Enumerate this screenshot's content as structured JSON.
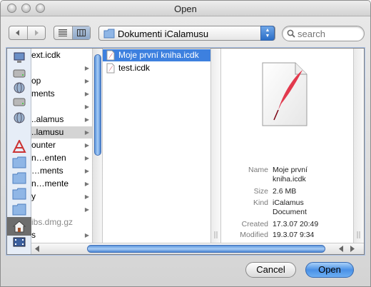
{
  "window": {
    "title": "Open"
  },
  "toolbar": {
    "back_icon": "back-arrow-icon",
    "forward_icon": "forward-arrow-icon",
    "location": "Dokumenti iCalamusu",
    "search_placeholder": "search"
  },
  "sidebar": {
    "items": [
      "computer-icon",
      "disk-icon",
      "network-disk-icon",
      "disk-icon",
      "network-disk-icon",
      "applications-icon",
      "folder-icon",
      "folder-icon",
      "folder-icon",
      "folder-icon",
      "home-icon",
      "movies-icon"
    ]
  },
  "column1": {
    "rows": [
      {
        "label": "ext.icdk",
        "arrow": false
      },
      {
        "label": "",
        "arrow": true
      },
      {
        "label": "op",
        "arrow": true
      },
      {
        "label": "ments",
        "arrow": true
      },
      {
        "label": "",
        "arrow": true
      },
      {
        "label": "..alamus",
        "arrow": true
      },
      {
        "label": "..lamusu",
        "arrow": true
      },
      {
        "label": "ounter",
        "arrow": true
      },
      {
        "label": "n…enten",
        "arrow": true
      },
      {
        "label": "…ments",
        "arrow": true
      },
      {
        "label": "n…mente",
        "arrow": true
      },
      {
        "label": "y",
        "arrow": true
      },
      {
        "label": "",
        "arrow": true
      },
      {
        "label": "ibs.dmg.gz",
        "arrow": false
      },
      {
        "label": "s",
        "arrow": true
      }
    ]
  },
  "column2": {
    "files": [
      {
        "label": "Moje první kniha.icdk"
      },
      {
        "label": "test.icdk"
      }
    ]
  },
  "preview": {
    "name_label": "Name",
    "name_line1": "Moje první",
    "name_line2": "kniha.icdk",
    "size_label": "Size",
    "size": "2.6 MB",
    "kind_label": "Kind",
    "kind_line1": "iCalamus",
    "kind_line2": "Document",
    "created_label": "Created",
    "created": "17.3.07 20:49",
    "modified_label": "Modified",
    "modified": "19.3.07 9:34"
  },
  "buttons": {
    "cancel": "Cancel",
    "open": "Open"
  },
  "colors": {
    "selection": "#3d80df",
    "accent": "#4a91e6",
    "quill": "#c8102e"
  }
}
